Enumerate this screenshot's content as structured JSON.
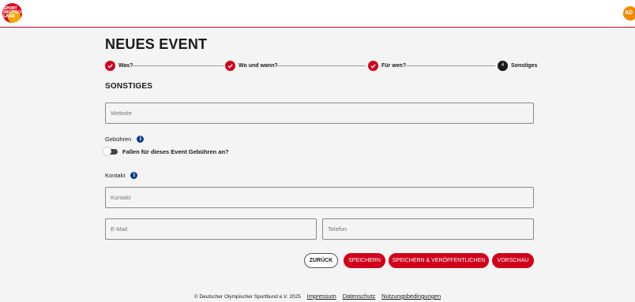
{
  "header": {
    "logo_text": "SPORT DEUTSCH LAND",
    "avatar_initials": "AD"
  },
  "page": {
    "title": "NEUES EVENT",
    "section_title": "SONSTIGES"
  },
  "stepper": {
    "steps": [
      {
        "label": "Was?",
        "status": "done"
      },
      {
        "label": "Wo und wann?",
        "status": "done"
      },
      {
        "label": "Für wen?",
        "status": "done"
      },
      {
        "label": "Sonstiges",
        "status": "active",
        "number": "4"
      }
    ]
  },
  "form": {
    "website_placeholder": "Website",
    "fees_label": "Gebühren",
    "fees_toggle_label": "Fallen für dieses Event Gebühren an?",
    "fees_toggle_on": false,
    "contact_label": "Kontakt",
    "contact_placeholder": "Kontakt",
    "email_placeholder": "E-Mail",
    "phone_placeholder": "Telefon",
    "info_icon": "i"
  },
  "actions": {
    "back": "ZURÜCK",
    "save": "SPEICHERN",
    "save_publish": "SPEICHERN & VERÖFFENTLICHEN",
    "preview": "VORSCHAU"
  },
  "footer": {
    "copyright": "© Deutscher Olympischer Sportbund e.V. 2025",
    "links": [
      "Impressum",
      "Datenschutz",
      "Nutzungsbedingungen"
    ]
  },
  "colors": {
    "accent_red": "#d0021b",
    "info_blue": "#0b3b8c",
    "avatar_orange": "#f08a00"
  }
}
